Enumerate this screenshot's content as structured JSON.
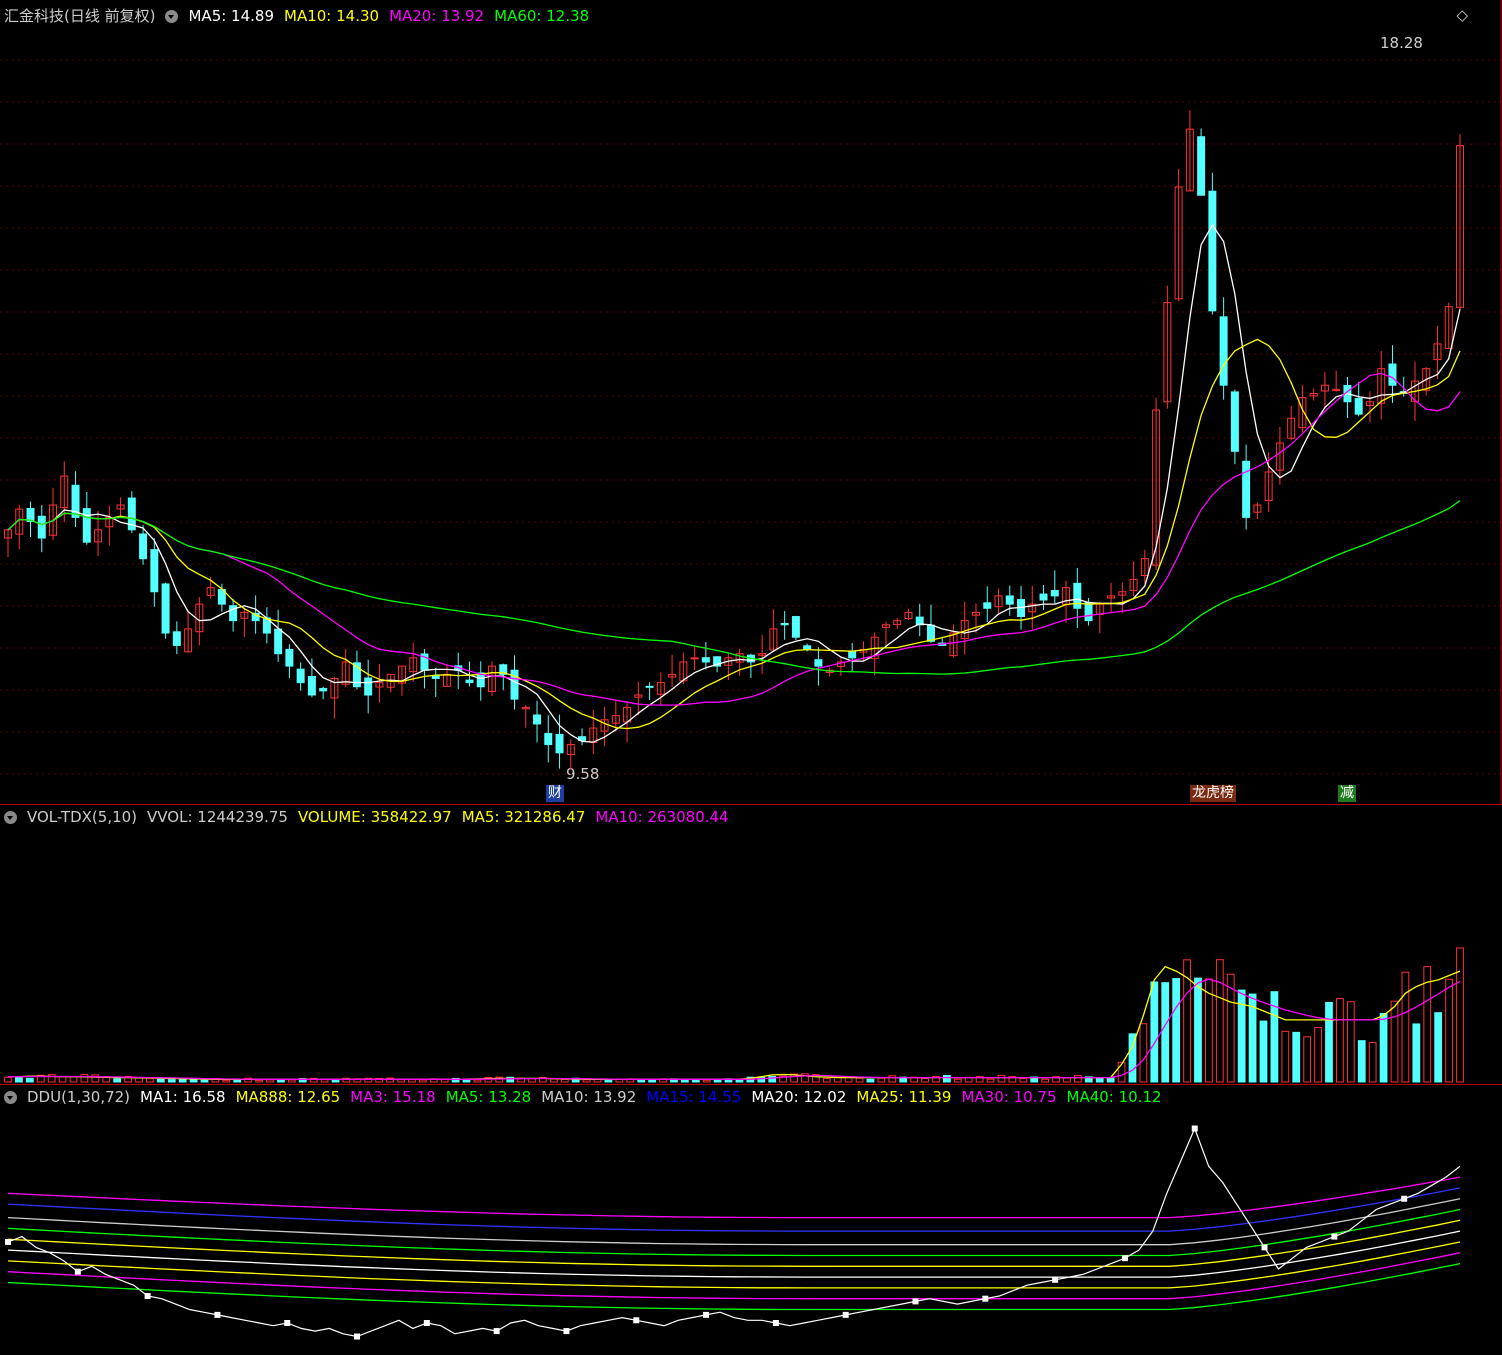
{
  "stock": {
    "name": "汇金科技(日线 前复权)",
    "legend": [
      {
        "label": "MA5: 14.89",
        "color": "#ffffff"
      },
      {
        "label": "MA10: 14.30",
        "color": "#ffff00"
      },
      {
        "label": "MA20: 13.92",
        "color": "#ff00ff"
      },
      {
        "label": "MA60: 12.38",
        "color": "#00ff00"
      }
    ],
    "high_label": "18.28",
    "low_label": "9.58",
    "markers": [
      {
        "text": "财",
        "bg": "#1f3f9f",
        "color": "#ffffff"
      },
      {
        "text": "龙虎榜",
        "bg": "#7a2a10",
        "color": "#ffffff"
      },
      {
        "text": "减",
        "bg": "#207a20",
        "color": "#ffffff"
      }
    ]
  },
  "volume": {
    "title": "VOL-TDX(5,10)",
    "legend": [
      {
        "label": "VVOL: 1244239.75",
        "color": "#cccccc"
      },
      {
        "label": "VOLUME: 358422.97",
        "color": "#ffff00"
      },
      {
        "label": "MA5: 321286.47",
        "color": "#ffff00"
      },
      {
        "label": "MA10: 263080.44",
        "color": "#ff00ff"
      }
    ]
  },
  "ddu": {
    "title": "DDU(1,30,72)",
    "legend": [
      {
        "label": "MA1: 16.58",
        "color": "#ffffff"
      },
      {
        "label": "MA888: 12.65",
        "color": "#ffff00"
      },
      {
        "label": "MA3: 15.18",
        "color": "#ff00ff"
      },
      {
        "label": "MA5: 13.28",
        "color": "#00ff00"
      },
      {
        "label": "MA10: 13.92",
        "color": "#cccccc"
      },
      {
        "label": "MA15: 14.55",
        "color": "#0000ff"
      },
      {
        "label": "MA20: 12.02",
        "color": "#ffffff"
      },
      {
        "label": "MA25: 11.39",
        "color": "#ffff00"
      },
      {
        "label": "MA30: 10.75",
        "color": "#ff00ff"
      },
      {
        "label": "MA40: 10.12",
        "color": "#00ff00"
      }
    ]
  },
  "chart_data": {
    "type": "candlestick",
    "title": "汇金科技(日线 前复权)",
    "price_range": [
      9.3,
      18.5
    ],
    "colors": {
      "up": "#ff3232",
      "down": "#54ffff",
      "ma5": "#ffffff",
      "ma10": "#ffff00",
      "ma20": "#ff00ff",
      "ma60": "#00ff00"
    },
    "close": [
      12.45,
      12.7,
      12.55,
      12.35,
      12.75,
      13.1,
      12.6,
      12.3,
      12.45,
      12.6,
      12.75,
      12.45,
      12.1,
      11.7,
      11.2,
      11.05,
      11.25,
      11.55,
      11.75,
      11.55,
      11.35,
      11.45,
      11.35,
      11.2,
      10.95,
      10.8,
      10.6,
      10.45,
      10.5,
      10.65,
      10.85,
      10.55,
      10.45,
      10.6,
      10.7,
      10.8,
      10.9,
      10.75,
      10.65,
      10.7,
      10.75,
      10.6,
      10.55,
      10.8,
      10.7,
      10.4,
      10.3,
      10.1,
      9.85,
      9.75,
      9.85,
      9.9,
      10.05,
      10.15,
      10.2,
      10.3,
      10.45,
      10.55,
      10.6,
      10.7,
      10.85,
      10.9,
      10.85,
      10.8,
      10.9,
      10.95,
      10.85,
      10.95,
      11.25,
      11.3,
      11.15,
      11.0,
      10.8,
      10.75,
      10.85,
      10.9,
      11.0,
      11.15,
      11.3,
      11.35,
      11.45,
      11.3,
      11.1,
      11.05,
      11.2,
      11.35,
      11.45,
      11.5,
      11.65,
      11.55,
      11.4,
      11.55,
      11.6,
      11.65,
      11.75,
      11.5,
      11.35,
      11.55,
      11.65,
      11.7,
      11.85,
      12.1,
      13.9,
      15.2,
      16.6,
      17.3,
      16.5,
      15.1,
      14.2,
      13.4,
      12.6,
      12.75,
      13.15,
      13.5,
      13.8,
      14.05,
      14.1,
      14.2,
      14.15,
      14.0,
      13.85,
      14.0,
      14.4,
      14.2,
      14.1,
      14.25,
      14.4,
      14.7,
      15.15,
      17.1
    ],
    "volume_ma5": [
      12000,
      12000,
      13000,
      13000,
      12500,
      12000,
      12000,
      11500,
      11000,
      10500,
      10000,
      10000,
      9500,
      9000,
      8500,
      8000,
      7500,
      7000,
      6500,
      6000,
      6000,
      6000,
      6000,
      6000,
      6000,
      6000,
      6000,
      6000,
      6000,
      6000,
      6000,
      6000,
      6000,
      6000,
      6000,
      6000,
      6000,
      6000,
      6000,
      6000,
      6000,
      6000,
      6500,
      7000,
      7500,
      8000,
      8000,
      8000,
      8000,
      8000,
      7500,
      7000,
      6500,
      6000,
      6000,
      6000,
      6000,
      6000,
      6000,
      6000,
      6000,
      6000,
      6000,
      6000,
      6000,
      6000,
      6000,
      6000,
      8000,
      12000,
      16000,
      17000,
      16000,
      14000,
      12000,
      11000,
      10000,
      10000,
      10000,
      10000,
      10000,
      10000,
      10000,
      10000,
      10000,
      10000,
      10000,
      10000,
      10000,
      10000,
      10000,
      10000,
      10000,
      10000,
      10000,
      10000,
      10000,
      10000,
      10000,
      10000,
      10000,
      10000,
      40000,
      80000,
      150000,
      230000,
      260000,
      250000,
      235000,
      215000,
      200000,
      190000,
      180000,
      175000,
      170000,
      160000,
      150000,
      140000,
      140000,
      140000,
      140000,
      140000,
      140000,
      140000,
      140000,
      140000,
      150000,
      170000,
      200000,
      215000,
      225000,
      230000,
      240000,
      250000
    ],
    "ddu_ma1": [
      13.8,
      14.0,
      13.6,
      13.4,
      13.1,
      12.7,
      12.9,
      12.6,
      12.4,
      12.2,
      11.8,
      11.7,
      11.5,
      11.3,
      11.2,
      11.1,
      11.0,
      10.9,
      10.8,
      10.7,
      10.8,
      10.6,
      10.5,
      10.6,
      10.4,
      10.3,
      10.5,
      10.7,
      10.9,
      10.6,
      10.8,
      10.7,
      10.4,
      10.5,
      10.6,
      10.5,
      10.8,
      10.9,
      10.7,
      10.6,
      10.5,
      10.7,
      10.8,
      10.9,
      11.0,
      10.9,
      10.8,
      10.7,
      10.9,
      11.0,
      11.1,
      11.2,
      11.0,
      10.9,
      10.9,
      10.8,
      10.7,
      10.8,
      10.9,
      11.0,
      11.1,
      11.2,
      11.3,
      11.4,
      11.5,
      11.6,
      11.7,
      11.6,
      11.5,
      11.6,
      11.7,
      11.8,
      12.0,
      12.2,
      12.3,
      12.4,
      12.5,
      12.6,
      12.8,
      13.0,
      13.2,
      13.5,
      14.2,
      15.6,
      16.8,
      18.0,
      16.6,
      16.0,
      15.2,
      14.4,
      13.6,
      12.8,
      13.2,
      13.6,
      13.8,
      14.0,
      14.2,
      14.6,
      15.0,
      15.2,
      15.4,
      15.6,
      15.9,
      16.2,
      16.6
    ],
    "ddu_bands": [
      {
        "name": "MA3",
        "color": "#ff00ff",
        "start": 15.6,
        "mid": 14.7,
        "end": 16.2
      },
      {
        "name": "MA15",
        "color": "#3333ff",
        "start": 15.2,
        "mid": 14.2,
        "end": 15.8
      },
      {
        "name": "MA10",
        "color": "#cccccc",
        "start": 14.7,
        "mid": 13.7,
        "end": 15.4
      },
      {
        "name": "MA5",
        "color": "#00ff00",
        "start": 14.3,
        "mid": 13.3,
        "end": 15.0
      },
      {
        "name": "MA888",
        "color": "#ffff00",
        "start": 13.9,
        "mid": 12.9,
        "end": 14.6
      },
      {
        "name": "MA20",
        "color": "#ffffff",
        "start": 13.5,
        "mid": 12.5,
        "end": 14.2
      },
      {
        "name": "MA25",
        "color": "#ffff00",
        "start": 13.1,
        "mid": 12.1,
        "end": 13.8
      },
      {
        "name": "MA30",
        "color": "#ff00ff",
        "start": 12.7,
        "mid": 11.7,
        "end": 13.4
      },
      {
        "name": "MA40",
        "color": "#00ff00",
        "start": 12.3,
        "mid": 11.3,
        "end": 13.0
      }
    ]
  }
}
